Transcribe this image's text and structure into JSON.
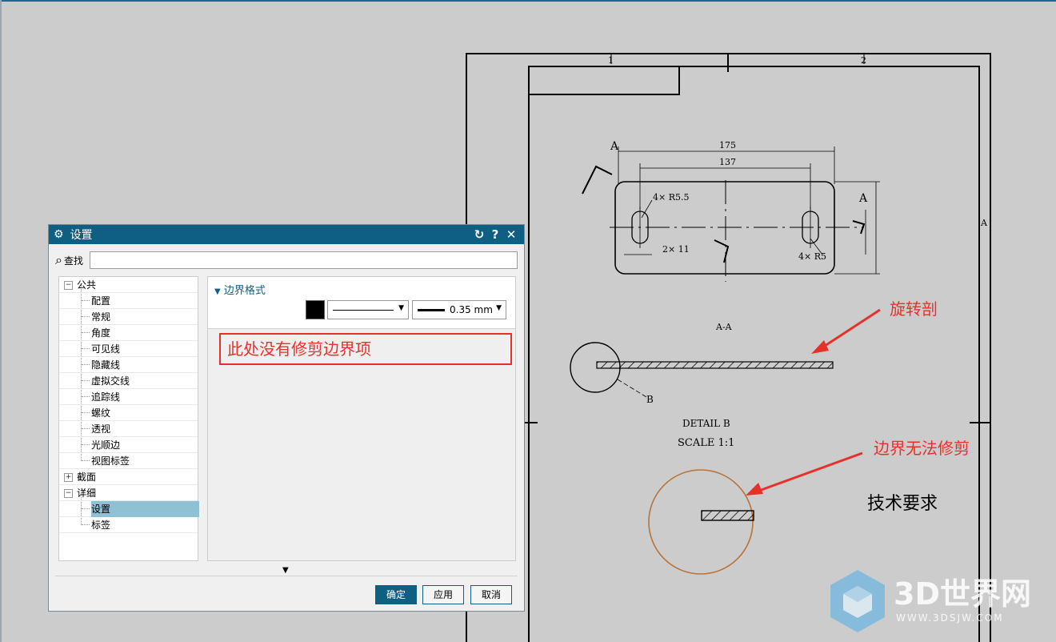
{
  "dialog": {
    "title": "设置",
    "title_icon": "gear-icon",
    "reset_icon": "reset-icon",
    "help_icon": "help-icon",
    "close_icon": "close-icon",
    "search_label": "查找",
    "search_value": "",
    "tree": [
      {
        "label": "公共",
        "level": 1,
        "expander": "−"
      },
      {
        "label": "配置",
        "level": 2
      },
      {
        "label": "常规",
        "level": 2
      },
      {
        "label": "角度",
        "level": 2
      },
      {
        "label": "可见线",
        "level": 2
      },
      {
        "label": "隐藏线",
        "level": 2
      },
      {
        "label": "虚拟交线",
        "level": 2
      },
      {
        "label": "追踪线",
        "level": 2
      },
      {
        "label": "螺纹",
        "level": 2
      },
      {
        "label": "透视",
        "level": 2
      },
      {
        "label": "光顺边",
        "level": 2
      },
      {
        "label": "视图标签",
        "level": 2
      },
      {
        "label": "截面",
        "level": 1,
        "expander": "+"
      },
      {
        "label": "详细",
        "level": 1,
        "expander": "−"
      },
      {
        "label": "设置",
        "level": 2,
        "selected": true
      },
      {
        "label": "标签",
        "level": 2
      }
    ],
    "section_title": "边界格式",
    "border_color": "#000000",
    "line_width": "0.35 mm",
    "buttons": {
      "ok": "确定",
      "apply": "应用",
      "cancel": "取消"
    }
  },
  "annotations": {
    "dialog_note": "此处没有修剪边界项",
    "label1": "旋转剖",
    "label2": "边界无法修剪"
  },
  "drawing": {
    "zone_labels": [
      "1",
      "2",
      "A"
    ],
    "dim_175": "175",
    "dim_137": "137",
    "note_slot1": "4× R5.5",
    "note_2x11": "2× 11",
    "note_slot2": "4× R5",
    "section_letter": "A",
    "section_view_label": "A-A",
    "detail_letter": "B",
    "detail_label": "DETAIL B",
    "scale_label": "SCALE 1:1",
    "tech_req": "技术要求"
  },
  "watermark": {
    "brand": "3D世界网",
    "url": "WWW.3DSJW.COM"
  }
}
